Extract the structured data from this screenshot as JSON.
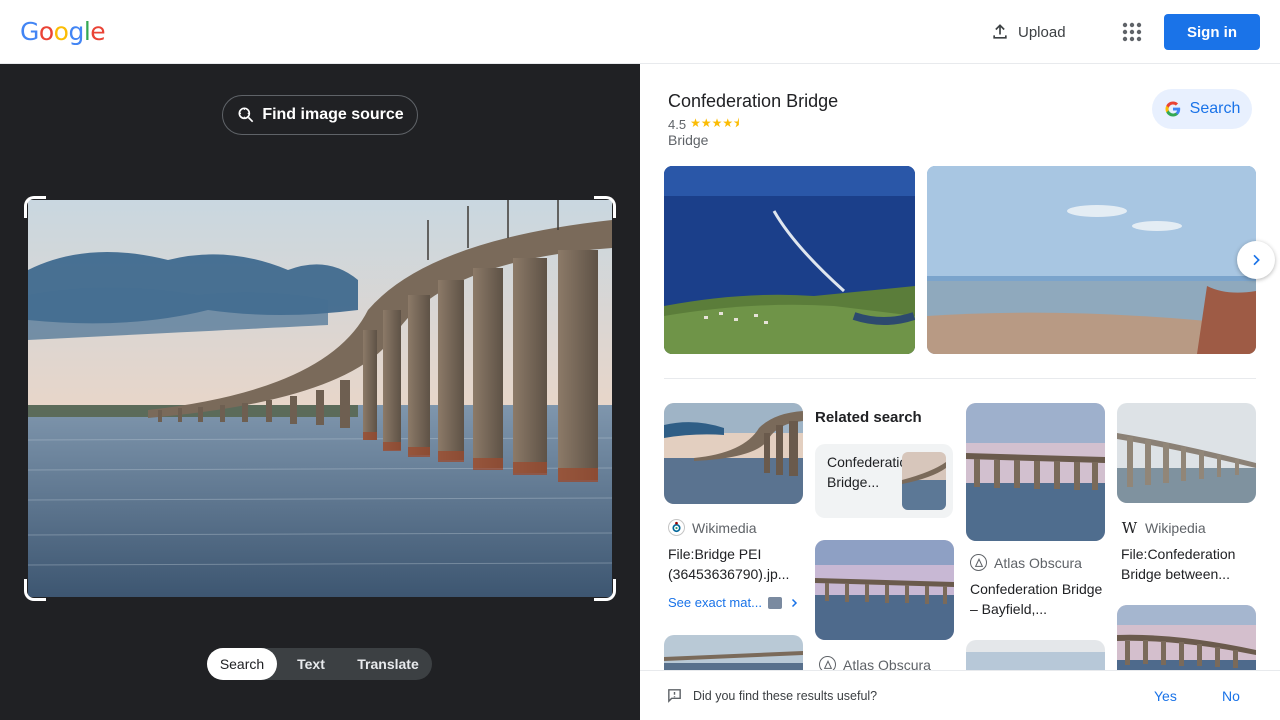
{
  "header": {
    "logo": [
      "G",
      "o",
      "o",
      "g",
      "l",
      "e"
    ],
    "logo_colors": [
      "#4285f4",
      "#ea4335",
      "#fbbc05",
      "#4285f4",
      "#34a853",
      "#ea4335"
    ],
    "upload_label": "Upload",
    "signin_label": "Sign in"
  },
  "left": {
    "find_source_label": "Find image source",
    "tabs": [
      "Search",
      "Text",
      "Translate"
    ],
    "active_tab": "Search"
  },
  "knowledge_panel": {
    "title": "Confederation Bridge",
    "rating": "4.5",
    "stars": "★★★★⯨",
    "type": "Bridge",
    "search_label": "Search"
  },
  "results": {
    "related_heading": "Related search",
    "related_query": "Confederation Bridge...",
    "items": [
      {
        "source": "Wikimedia",
        "title": "File:Bridge PEI (36453636790).jp..."
      },
      {
        "source": "Atlas Obscura",
        "title": "Confederation Bridge – Bayfield,..."
      },
      {
        "source": "Wikipedia",
        "title": "File:Confederation Bridge between..."
      },
      {
        "source": "Atlas Obscura",
        "title": ""
      }
    ],
    "see_exact": "See exact mat..."
  },
  "feedback": {
    "question": "Did you find these results useful?",
    "yes": "Yes",
    "no": "No"
  },
  "colors": {
    "accent": "#1a73e8",
    "dark_panel": "#202124",
    "star": "#fbbc04"
  }
}
